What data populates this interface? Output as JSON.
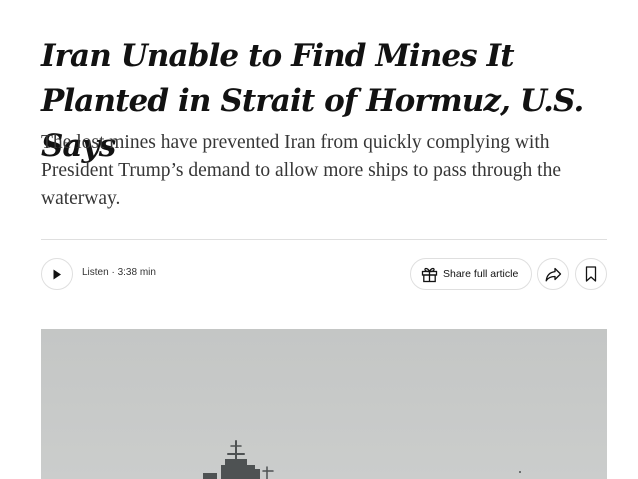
{
  "article": {
    "headline": "Iran Unable to Find Mines It Planted in Strait of Hormuz, U.S. Says",
    "summary": "The lost mines have prevented Iran from quickly complying with President Trump’s demand to allow more ships to pass through the waterway."
  },
  "toolbar": {
    "listen_label": "Listen · 3:38 min",
    "share_label": "Share full article",
    "icons": {
      "play": "play-icon",
      "gift": "gift-icon",
      "share": "share-arrow-icon",
      "bookmark": "bookmark-icon"
    }
  },
  "colors": {
    "text": "#121212",
    "summary_text": "#363636",
    "border": "#dfdfdf",
    "photo_sky": "#c7c9c8"
  }
}
